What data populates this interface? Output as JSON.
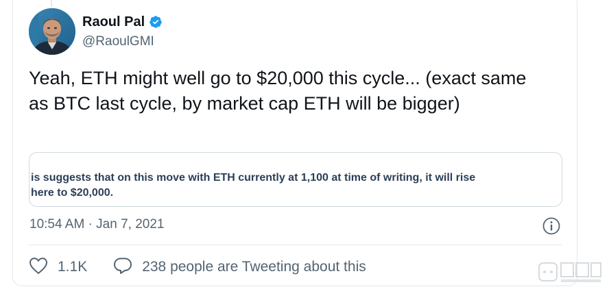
{
  "author": {
    "display_name": "Raoul Pal",
    "handle": "@RaoulGMI",
    "verified": true
  },
  "tweet": {
    "text": "Yeah, ETH might well go to $20,000 this cycle... (exact same as BTC last cycle, by market cap ETH will be bigger)",
    "timestamp": "10:54 AM · Jan 7, 2021"
  },
  "media": {
    "line1": "is suggests that on this move with ETH currently at 1,100 at time of writing, it will rise",
    "line2": " here to $20,000."
  },
  "actions": {
    "likes": "1.1K",
    "tweeting_text": "238 people are Tweeting about this"
  },
  "icons": {
    "verified": "verified-badge-icon",
    "info": "info-icon",
    "like": "heart-icon",
    "reply": "speech-bubble-icon"
  },
  "colors": {
    "accent": "#1d9bf0",
    "text_primary": "#0f1419",
    "text_secondary": "#536471",
    "border": "#e1e8ed",
    "media_text": "#2c3f58"
  }
}
